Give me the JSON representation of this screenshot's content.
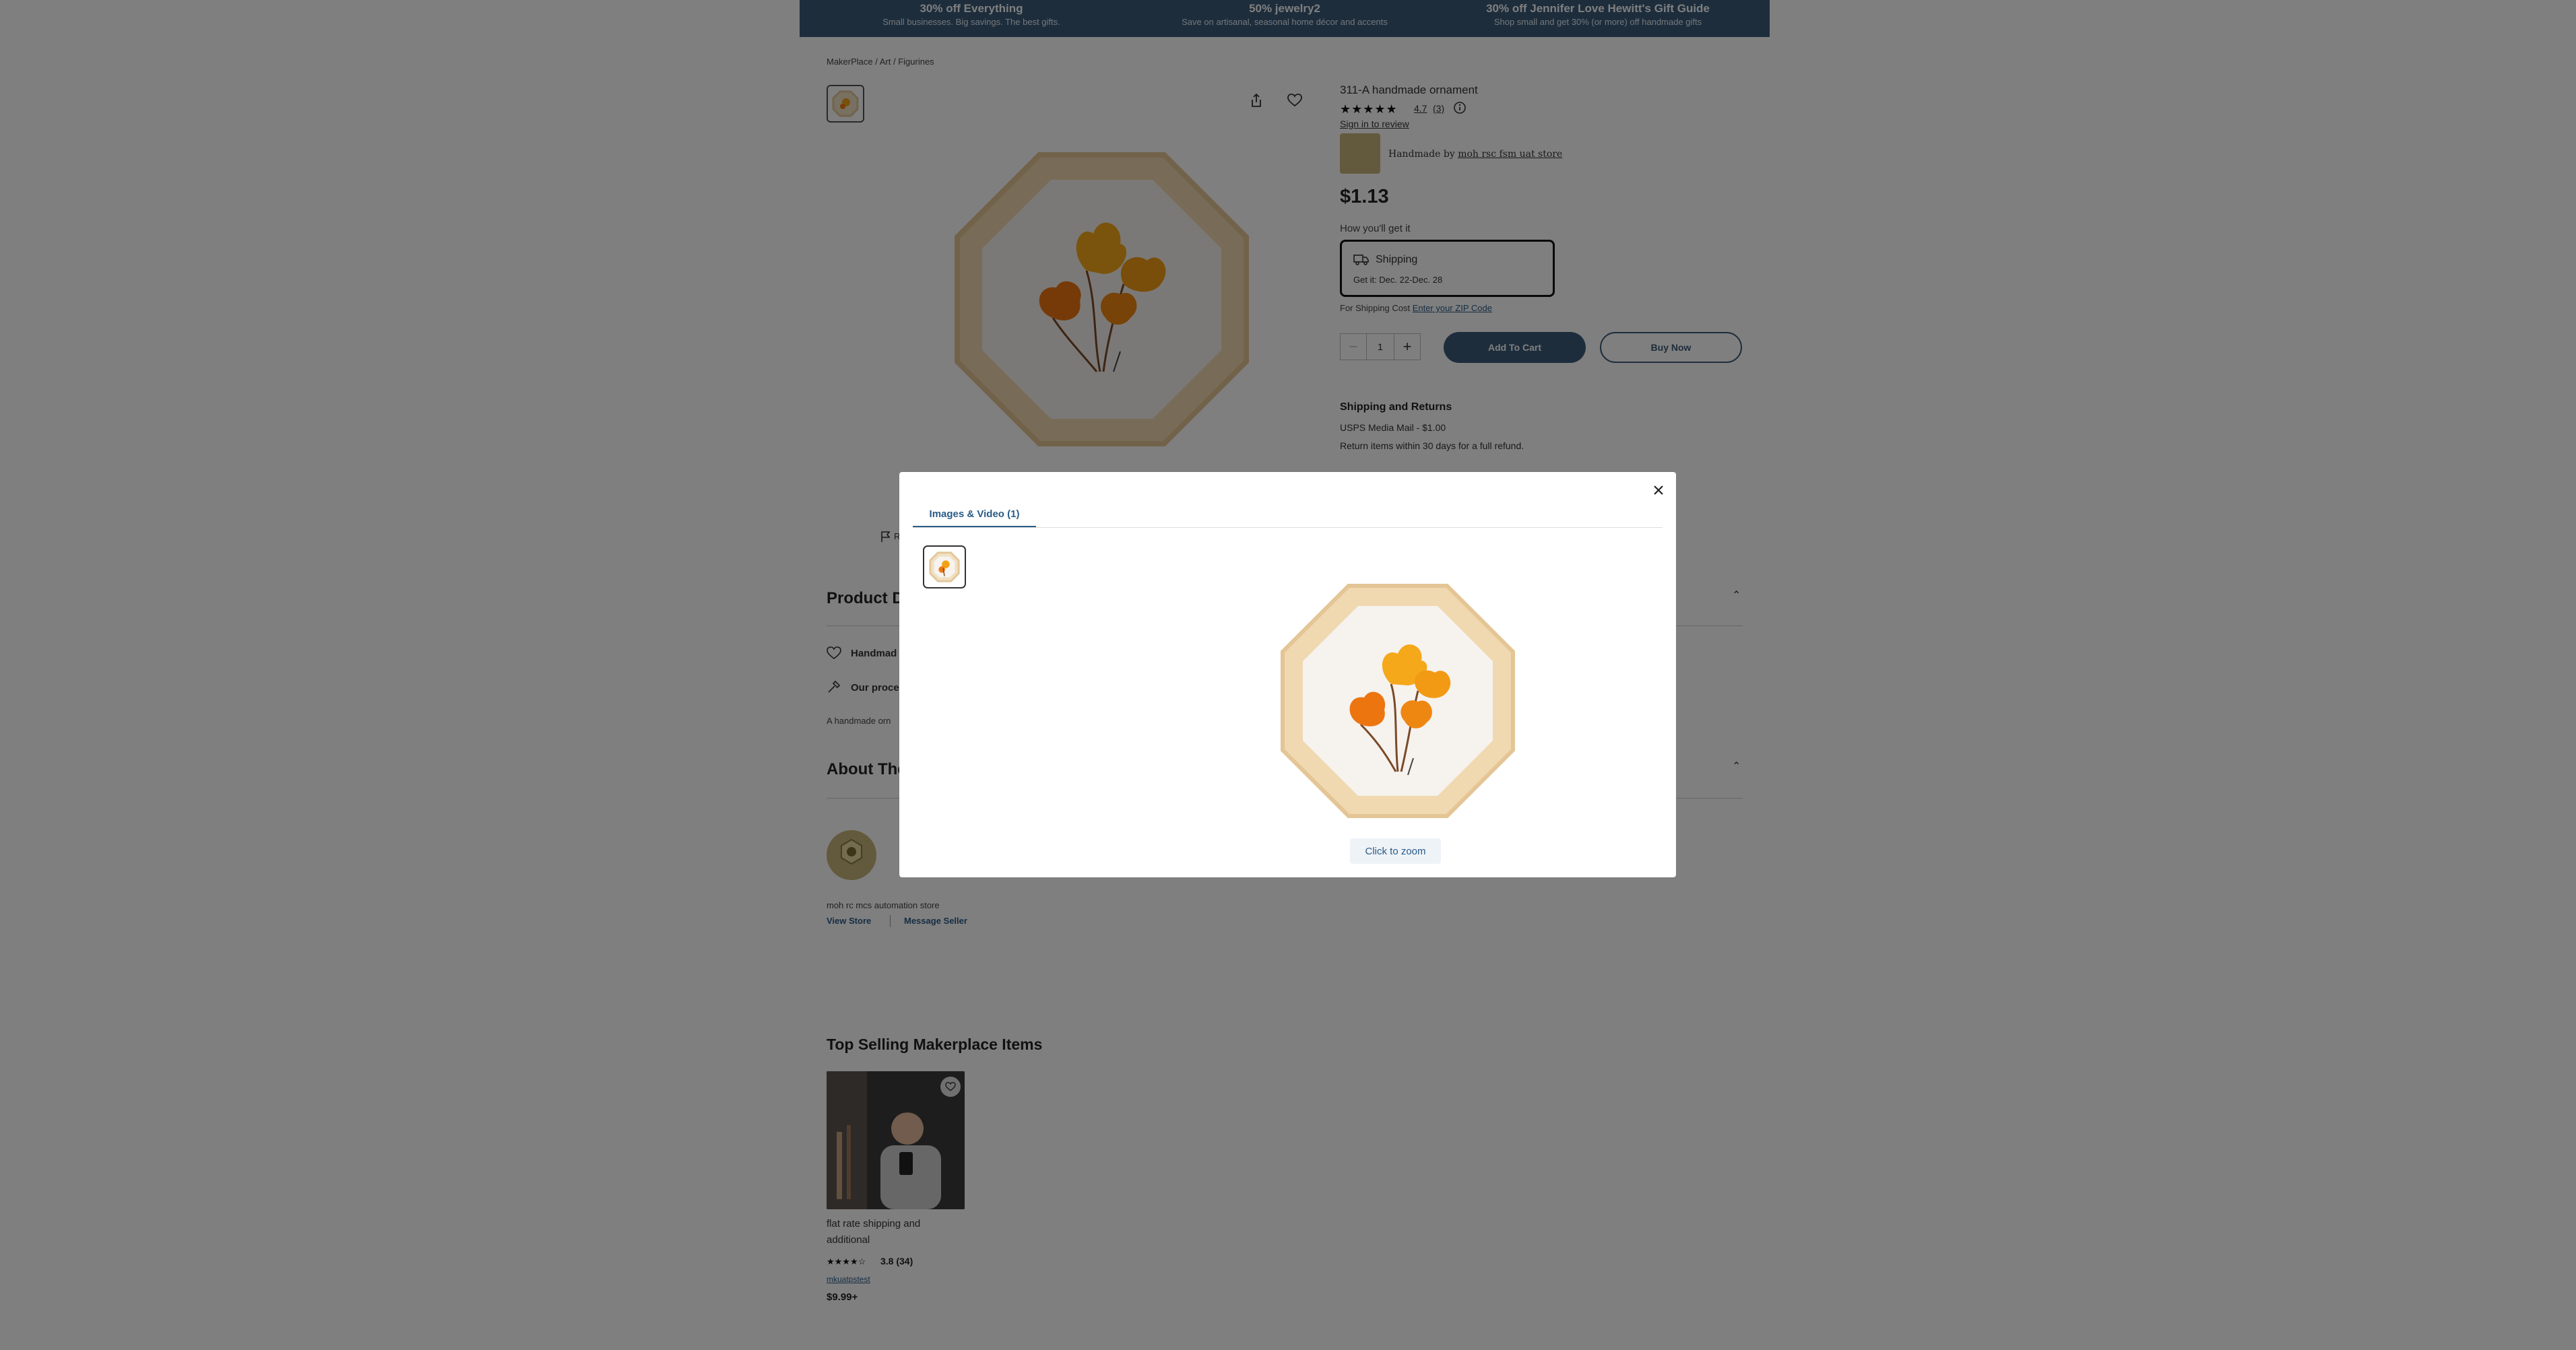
{
  "promo": [
    {
      "title": "30% off Everything",
      "sub": "Small businesses. Big savings. The best gifts."
    },
    {
      "title": "50% jewelry2",
      "sub": "Save on artisanal, seasonal home décor and accents"
    },
    {
      "title": "30% off Jennifer Love Hewitt's Gift Guide",
      "sub": "Shop small and get 30% (or more) off handmade gifts"
    }
  ],
  "breadcrumb": "MakerPlace / Art / Figurines",
  "product": {
    "title": "311-A handmade ornament",
    "stars": "★★★★★",
    "rating": "4.7",
    "rating_count": "(3)",
    "sign_in_review": "Sign in to review",
    "handmade_by_prefix": "Handmade by",
    "seller_link": "moh rsc fsm uat store",
    "price": "$1.13",
    "how_get": "How you'll get it",
    "shipping_label": "Shipping",
    "shipping_get": "Get it: Dec. 22-Dec. 28",
    "shipping_cost_prefix": "For Shipping Cost",
    "shipping_cost_link": "Enter your ZIP Code",
    "quantity": "1",
    "qty_minus": "−",
    "qty_plus": "+",
    "add_to_cart": "Add To Cart",
    "buy_now": "Buy Now",
    "shipping_returns_title": "Shipping and Returns",
    "shipping_method": "USPS Media Mail - $1.00",
    "returns_text": "Return items within 30 days for a full refund."
  },
  "details": {
    "report_partial": "R",
    "product_details_title": "Product D",
    "handmade_partial": "Handmad",
    "process_partial": "Our proce",
    "desc_partial": "A handmade orn",
    "about_title": "About The",
    "store_name": "moh rc mcs automation store",
    "view_store": "View Store",
    "message_seller": "Message Seller"
  },
  "top_selling": {
    "title": "Top Selling Makerplace Items",
    "item": {
      "title": "flat rate shipping and additional",
      "stars": "★★★★☆",
      "rating": "3.8 (34)",
      "seller": "mkuatpstest",
      "price": "$9.99+"
    }
  },
  "modal": {
    "tab_label": "Images & Video (1)",
    "zoom_label": "Click to zoom"
  }
}
